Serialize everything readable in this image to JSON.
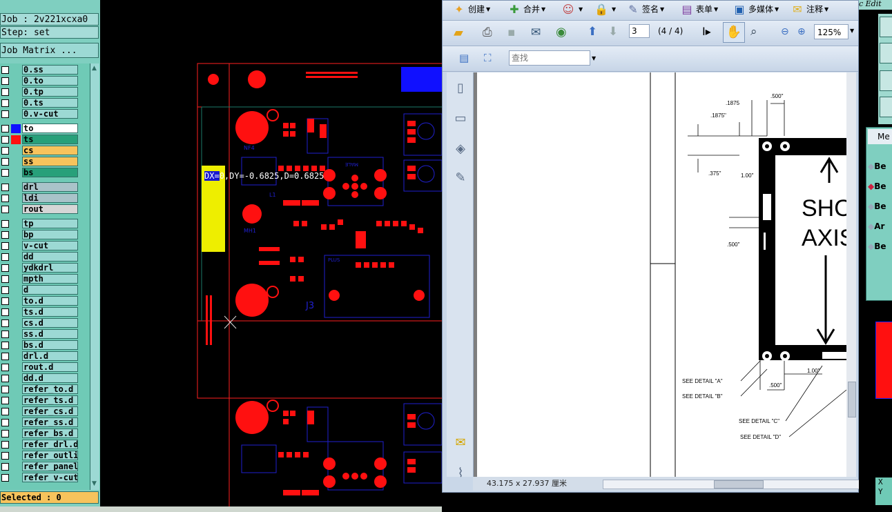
{
  "cam": {
    "job_label": "Job : 2v221xcxa0",
    "step_label": "Step: set",
    "matrix_button": "Job Matrix ...",
    "selected_label": "Selected : 0",
    "layers": [
      {
        "name": "0.ss",
        "color": "#9cd9d4",
        "swatch": ""
      },
      {
        "name": "0.to",
        "color": "#9cd9d4",
        "swatch": ""
      },
      {
        "name": "0.tp",
        "color": "#9cd9d4",
        "swatch": ""
      },
      {
        "name": "0.ts",
        "color": "#9cd9d4",
        "swatch": ""
      },
      {
        "name": "0.v-cut",
        "color": "#9cd9d4",
        "swatch": ""
      },
      {
        "name": "to",
        "color": "#ffffff",
        "swatch": "#1010ff"
      },
      {
        "name": "ts",
        "color": "#27a07a",
        "swatch": "#ff1010"
      },
      {
        "name": "cs",
        "color": "#f7c35c",
        "swatch": ""
      },
      {
        "name": "ss",
        "color": "#f7c35c",
        "swatch": ""
      },
      {
        "name": "bs",
        "color": "#27a07a",
        "swatch": ""
      },
      {
        "name": "drl",
        "color": "#a9c3c9",
        "swatch": ""
      },
      {
        "name": "ldi",
        "color": "#a9c3c9",
        "swatch": ""
      },
      {
        "name": "rout",
        "color": "#d6d6d6",
        "swatch": ""
      },
      {
        "name": "tp",
        "color": "#9cd9d4",
        "swatch": ""
      },
      {
        "name": "bp",
        "color": "#9cd9d4",
        "swatch": ""
      },
      {
        "name": "v-cut",
        "color": "#9cd9d4",
        "swatch": ""
      },
      {
        "name": "dd",
        "color": "#9cd9d4",
        "swatch": ""
      },
      {
        "name": "ydkdrl",
        "color": "#9cd9d4",
        "swatch": ""
      },
      {
        "name": "mpth",
        "color": "#9cd9d4",
        "swatch": ""
      },
      {
        "name": "d",
        "color": "#9cd9d4",
        "swatch": ""
      },
      {
        "name": "to.d",
        "color": "#9cd9d4",
        "swatch": ""
      },
      {
        "name": "ts.d",
        "color": "#9cd9d4",
        "swatch": ""
      },
      {
        "name": "cs.d",
        "color": "#9cd9d4",
        "swatch": ""
      },
      {
        "name": "ss.d",
        "color": "#9cd9d4",
        "swatch": ""
      },
      {
        "name": "bs.d",
        "color": "#9cd9d4",
        "swatch": ""
      },
      {
        "name": "drl.d",
        "color": "#9cd9d4",
        "swatch": ""
      },
      {
        "name": "rout.d",
        "color": "#9cd9d4",
        "swatch": ""
      },
      {
        "name": "dd.d",
        "color": "#9cd9d4",
        "swatch": ""
      },
      {
        "name": "refer_to.d",
        "color": "#9cd9d4",
        "swatch": ""
      },
      {
        "name": "refer_ts.d",
        "color": "#9cd9d4",
        "swatch": ""
      },
      {
        "name": "refer_cs.d",
        "color": "#9cd9d4",
        "swatch": ""
      },
      {
        "name": "refer_ss.d",
        "color": "#9cd9d4",
        "swatch": ""
      },
      {
        "name": "refer_bs.d",
        "color": "#9cd9d4",
        "swatch": ""
      },
      {
        "name": "refer_drl.d",
        "color": "#9cd9d4",
        "swatch": ""
      },
      {
        "name": "refer_outli",
        "color": "#9cd9d4",
        "swatch": ""
      },
      {
        "name": "refer_panel",
        "color": "#9cd9d4",
        "swatch": ""
      },
      {
        "name": "refer_v-cut",
        "color": "#9cd9d4",
        "swatch": ""
      }
    ],
    "measure": {
      "dx": "DX=",
      "rest": "0,DY=-0.6825,D=0.6825"
    },
    "silk_labels": {
      "nf4": "NF4",
      "j3": "J3",
      "mh1": "MH1",
      "l1": "L1",
      "male": "MALE",
      "plus": "PLUS"
    }
  },
  "acrobat": {
    "menu": [
      {
        "label": "创建",
        "icon": "create-icon"
      },
      {
        "label": "合并",
        "icon": "combine-icon"
      },
      {
        "label": "",
        "icon": "collaborate-icon"
      },
      {
        "label": "",
        "icon": "secure-icon"
      },
      {
        "label": "签名",
        "icon": "sign-icon"
      },
      {
        "label": "表单",
        "icon": "forms-icon"
      },
      {
        "label": "多媒体",
        "icon": "multimedia-icon"
      },
      {
        "label": "注释",
        "icon": "comment-icon"
      }
    ],
    "page_input": "3",
    "page_count": "(4 / 4)",
    "zoom": "125%",
    "search_placeholder": "查找",
    "status_size": "43.175 x 27.937 厘米",
    "drawing": {
      "dim1": ".1875",
      "dim2": ".1875\"",
      "dim3": ".500\"",
      "dim4": ".375\"",
      "dim5": "1.00\"",
      "dim6": ".500\"",
      "dim7": ".500\"",
      "dim8": "1.00\"",
      "text1": "SHO",
      "text2": "AXIS",
      "detailA": "SEE DETAIL \"A\"",
      "detailB": "SEE DETAIL \"B\"",
      "detailC": "SEE DETAIL \"C\"",
      "detailD": "SEE DETAIL \"D\""
    }
  },
  "right": {
    "title": "c Edit",
    "panel_title": "Me",
    "items": [
      "Be",
      "Be",
      "Be",
      "Ar",
      "Be"
    ],
    "xy": [
      "X",
      "Y"
    ]
  }
}
